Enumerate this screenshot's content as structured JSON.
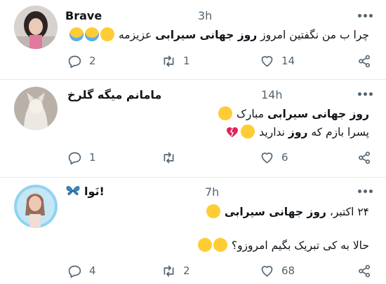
{
  "colors": {
    "text": "#0f1419",
    "muted": "#536471",
    "divider": "#e4e8ec",
    "emoji_yellow": "#ffcc33",
    "heart_break": "#e0245e",
    "butterfly": "#3b88c3"
  },
  "tweets": [
    {
      "display_name": "Brave",
      "time": "3h",
      "text_plain": "چرا ب من نگفتین امروز ",
      "text_bold": "روز جهانی سیرابی",
      "text_tail": " عزیزمه",
      "emojis": [
        "relieved-face-icon",
        "loudly-crying-face-icon",
        "loudly-crying-face-icon"
      ],
      "replies": "2",
      "retweets": "1",
      "likes": "14"
    },
    {
      "display_name": "مامانم میگه گلرخ",
      "time": "14h",
      "line1_bold": "روز جهانی سیرابی",
      "line1_plain": " مبارک",
      "line2_pre": "پسرا بازم که ",
      "line2_bold": "روز",
      "line2_post": " ندارید",
      "emojis": [
        "relieved-face-icon",
        "pensive-face-icon",
        "broken-heart-icon"
      ],
      "replies": "1",
      "retweets": "",
      "likes": "6"
    },
    {
      "display_name": "نَوا!",
      "name_icon": "butterfly-icon",
      "time": "7h",
      "line1_plain": "۲۴ اکتبر، ",
      "line1_bold": "روز جهانی سیرابی",
      "line2": "حالا به کی تبریک بگیم امروزو؟",
      "emojis": [
        "confused-face-icon",
        "rolling-on-floor-laughing-icon",
        "rolling-on-floor-laughing-icon"
      ],
      "replies": "4",
      "retweets": "2",
      "likes": "68"
    }
  ]
}
